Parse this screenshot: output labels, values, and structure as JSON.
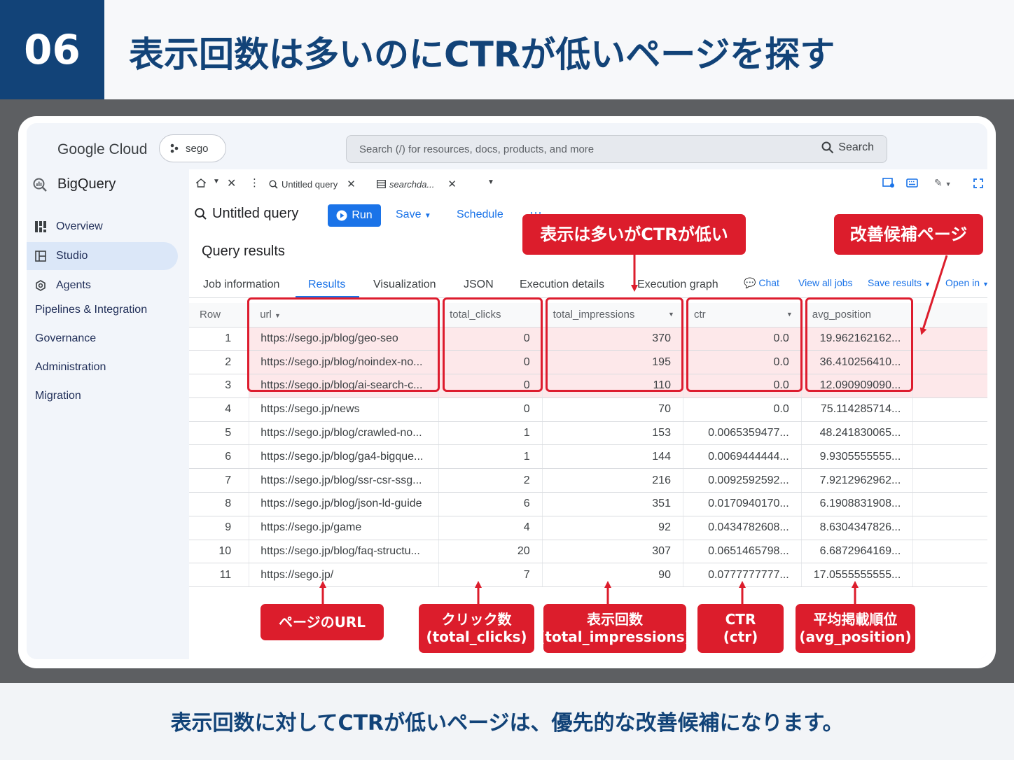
{
  "slide": {
    "number": "06",
    "title": "表示回数は多いのにCTRが低いページを探す",
    "caption": "表示回数に対してCTRが低いページは、優先的な改善候補になります。"
  },
  "topbar": {
    "logo": "Google Cloud",
    "project": "sego",
    "search_placeholder": "Search (/) for resources, docs, products, and more",
    "search_button": "Search"
  },
  "sidebar": {
    "product": "BigQuery",
    "items": [
      {
        "label": "Overview",
        "icon": "overview-icon"
      },
      {
        "label": "Studio",
        "icon": "studio-icon"
      },
      {
        "label": "Agents",
        "icon": "agents-icon"
      }
    ],
    "sections": [
      "Pipelines & Integration",
      "Governance",
      "Administration",
      "Migration"
    ]
  },
  "tabs": {
    "items": [
      "Untitled query",
      "searchda..."
    ]
  },
  "toolbar": {
    "query_title": "Untitled query",
    "run": "Run",
    "save": "Save",
    "schedule": "Schedule",
    "more": "⋯"
  },
  "results": {
    "title": "Query results",
    "tabs": [
      "Job information",
      "Results",
      "Visualization",
      "JSON",
      "Execution details",
      "Execution graph"
    ],
    "links": [
      "Chat",
      "View all jobs",
      "Save results",
      "Open in"
    ],
    "columns": [
      "Row",
      "url",
      "total_clicks",
      "total_impressions",
      "ctr",
      "avg_position"
    ],
    "rows": [
      {
        "row": "1",
        "url": "https://sego.jp/blog/geo-seo",
        "clicks": "0",
        "impressions": "370",
        "ctr": "0.0",
        "pos": "19.962162162..."
      },
      {
        "row": "2",
        "url": "https://sego.jp/blog/noindex-no...",
        "clicks": "0",
        "impressions": "195",
        "ctr": "0.0",
        "pos": "36.410256410..."
      },
      {
        "row": "3",
        "url": "https://sego.jp/blog/ai-search-c...",
        "clicks": "0",
        "impressions": "110",
        "ctr": "0.0",
        "pos": "12.090909090..."
      },
      {
        "row": "4",
        "url": "https://sego.jp/news",
        "clicks": "0",
        "impressions": "70",
        "ctr": "0.0",
        "pos": "75.114285714..."
      },
      {
        "row": "5",
        "url": "https://sego.jp/blog/crawled-no...",
        "clicks": "1",
        "impressions": "153",
        "ctr": "0.0065359477...",
        "pos": "48.241830065..."
      },
      {
        "row": "6",
        "url": "https://sego.jp/blog/ga4-bigque...",
        "clicks": "1",
        "impressions": "144",
        "ctr": "0.0069444444...",
        "pos": "9.9305555555..."
      },
      {
        "row": "7",
        "url": "https://sego.jp/blog/ssr-csr-ssg...",
        "clicks": "2",
        "impressions": "216",
        "ctr": "0.0092592592...",
        "pos": "7.9212962962..."
      },
      {
        "row": "8",
        "url": "https://sego.jp/blog/json-ld-guide",
        "clicks": "6",
        "impressions": "351",
        "ctr": "0.0170940170...",
        "pos": "6.1908831908..."
      },
      {
        "row": "9",
        "url": "https://sego.jp/game",
        "clicks": "4",
        "impressions": "92",
        "ctr": "0.0434782608...",
        "pos": "8.6304347826..."
      },
      {
        "row": "10",
        "url": "https://sego.jp/blog/faq-structu...",
        "clicks": "20",
        "impressions": "307",
        "ctr": "0.0651465798...",
        "pos": "6.6872964169..."
      },
      {
        "row": "11",
        "url": "https://sego.jp/",
        "clicks": "7",
        "impressions": "90",
        "ctr": "0.0777777777...",
        "pos": "17.0555555555..."
      }
    ]
  },
  "annotations": {
    "top_left": "表示は多いがCTRが低い",
    "top_right": "改善候補ページ",
    "bottom": [
      {
        "line1": "ページのURL",
        "line2": ""
      },
      {
        "line1": "クリック数",
        "line2": "(total_clicks)"
      },
      {
        "line1": "表示回数",
        "line2": "(total_impressions)"
      },
      {
        "line1": "CTR",
        "line2": "(ctr)"
      },
      {
        "line1": "平均掲載順位",
        "line2": "(avg_position)"
      }
    ]
  },
  "colors": {
    "navy": "#124378",
    "accent_red": "#dc1d2c",
    "highlight": "#fde8ea",
    "link_blue": "#1a73e8"
  }
}
